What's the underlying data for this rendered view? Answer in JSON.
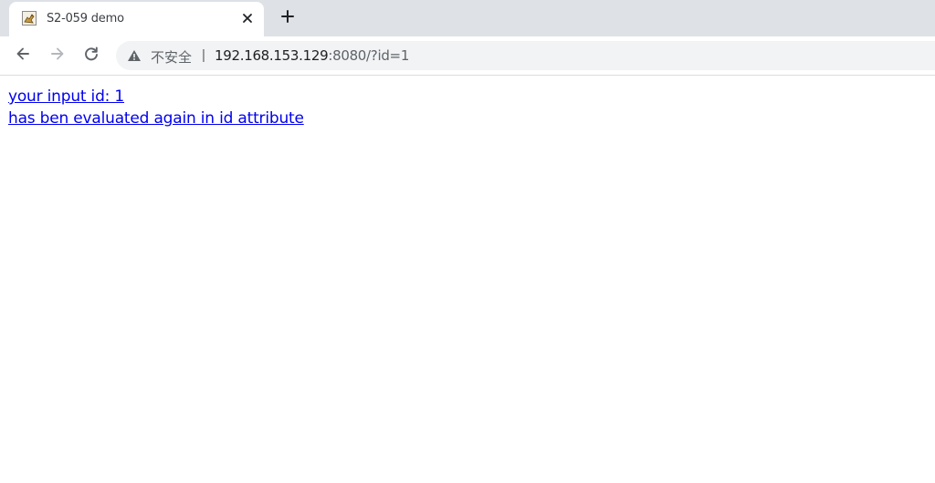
{
  "tab": {
    "title": "S2-059 demo",
    "favicon": "tomcat-favicon-icon",
    "close_icon": "close-icon",
    "new_tab_icon": "plus-icon"
  },
  "toolbar": {
    "back_icon": "arrow-left-icon",
    "forward_icon": "arrow-right-icon",
    "reload_icon": "reload-icon",
    "security_icon": "warning-triangle-icon",
    "security_label": "不安全",
    "separator": "|",
    "url_host": "192.168.153.129",
    "url_rest": ":8080/?id=1"
  },
  "page": {
    "line1": "your input id: 1",
    "line2": "has ben evaluated again in id attribute",
    "link_color": "#0000ee"
  },
  "colors": {
    "tabstrip": "#dee1e6",
    "omnibox": "#f1f3f4"
  }
}
